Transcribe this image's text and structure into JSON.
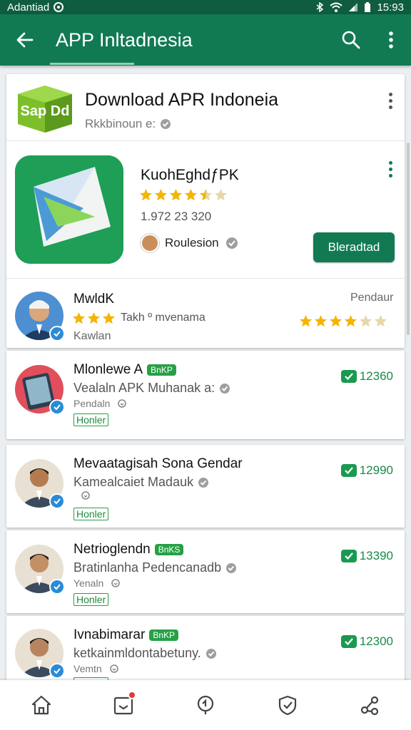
{
  "status_bar": {
    "carrier": "Adantiad",
    "time": "15:93"
  },
  "app_bar": {
    "title": "APP Inltadnesia",
    "back_icon": "arrow-back-icon",
    "search_icon": "search-icon",
    "menu_icon": "more-vert-icon"
  },
  "hero": {
    "logo_text": "Sap Dd",
    "title": "Download APR Indoneia",
    "subtitle": "Rkkbinoun e:",
    "app": {
      "name": "KuohEghdƒPK",
      "rating": 4.5,
      "count": "1.972 23 320",
      "developer": "Roulesion",
      "download_label": "Bleradtad"
    },
    "review": {
      "name": "MwldK",
      "rating_text": "Takh º mvenama",
      "subtext": "Kawlan",
      "right_label": "Pendaur",
      "right_rating": 4
    }
  },
  "list": [
    {
      "name": "Mlonlewe A",
      "pill": "BnKP",
      "line": "Vealaln APK Muhanak a:",
      "small": "Pendaln",
      "tag": "Honler",
      "count": "12360"
    },
    {
      "name": "Mevaatagisah Sona Gendar",
      "pill": "",
      "line": "Kamealcaiet Madauk",
      "small": "",
      "tag": "Honler",
      "count": "12990"
    },
    {
      "name": "Netrioglendn",
      "pill": "BnKS",
      "line": "Bratinlanha Pedencanadb",
      "small": "Yenaln",
      "tag": "Honler",
      "count": "13390"
    },
    {
      "name": "Ivnabimarar",
      "pill": "BnKP",
      "line": "ketkainmldontabetuny.",
      "small": "Vemtn",
      "tag": "Honler",
      "count": "12300"
    }
  ],
  "bottom_nav": [
    "home-icon",
    "inbox-icon",
    "location-icon",
    "shield-check-icon",
    "share-icon"
  ],
  "colors": {
    "primary": "#127a52",
    "accent": "#27a046",
    "star": "#f4b400"
  }
}
